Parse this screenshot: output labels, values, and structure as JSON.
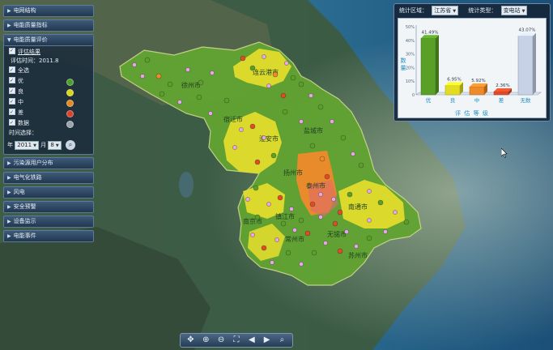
{
  "sidebar": {
    "top_items": [
      {
        "label": "电网结构"
      },
      {
        "label": "电能质量指标"
      }
    ],
    "panel": {
      "title": "电能质量评价",
      "sub_label": "评估结果",
      "time_text": "评估时间：2011.8",
      "legend": [
        {
          "label": "全选",
          "color": ""
        },
        {
          "label": "优",
          "color": "#4b9e2b"
        },
        {
          "label": "良",
          "color": "#d8d51a"
        },
        {
          "label": "中",
          "color": "#e08a24"
        },
        {
          "label": "差",
          "color": "#d9432a"
        },
        {
          "label": "数据",
          "color": "#9aa4ad"
        }
      ],
      "query_label": "时间选择：",
      "year_label": "年",
      "year_value": "2011",
      "month_label": "月",
      "month_value": "8"
    },
    "bottom_items": [
      {
        "label": "污染源用户分布"
      },
      {
        "label": "电气化铁路"
      },
      {
        "label": "风电"
      },
      {
        "label": "安全预警"
      },
      {
        "label": "设备监示"
      },
      {
        "label": "电能事件"
      }
    ]
  },
  "chart_panel": {
    "region_label": "统计区域：",
    "region_value": "江苏省",
    "type_label": "统计类型：",
    "type_value": "变电站",
    "y_title": "数量",
    "x_title": "评 估 等 级"
  },
  "chart_data": {
    "type": "bar",
    "categories": [
      "优",
      "良",
      "中",
      "差",
      "无数"
    ],
    "values": [
      41.49,
      6.95,
      5.92,
      2.36,
      43.07
    ],
    "value_labels": [
      "41.49%",
      "6.95%",
      "5.92%",
      "2.36%",
      "43.07%"
    ],
    "colors": [
      "#5aa028",
      "#e2dd22",
      "#ef8a2a",
      "#e04b28",
      "#c8d2e6"
    ],
    "ylim": [
      0,
      50
    ],
    "yticks": [
      "0",
      "10",
      "20",
      "30",
      "40",
      "50"
    ],
    "yticks_text": [
      "0",
      "10%",
      "20%",
      "30%",
      "40%",
      "50%"
    ],
    "grid": false,
    "style": "3d"
  },
  "map": {
    "city_labels": [
      "徐州市",
      "连云港市",
      "宿迁市",
      "淮安市",
      "盐城市",
      "扬州市",
      "泰州市",
      "南通市",
      "南京市",
      "镇江市",
      "常州市",
      "无锡市",
      "苏州市"
    ],
    "colors": {
      "good": "#5aa028",
      "fair": "#e2dd22",
      "medium": "#ef8a2a",
      "poor": "#e04b28",
      "user": "#e6a6e8"
    }
  },
  "toolbar": {
    "tools": [
      {
        "name": "pan-icon",
        "glyph": "✥"
      },
      {
        "name": "zoom-in-icon",
        "glyph": "⊕"
      },
      {
        "name": "zoom-out-icon",
        "glyph": "⊖"
      },
      {
        "name": "full-extent-icon",
        "glyph": "⛶"
      },
      {
        "name": "back-icon",
        "glyph": "◀"
      },
      {
        "name": "forward-icon",
        "glyph": "▶"
      },
      {
        "name": "search-icon",
        "glyph": "⌕"
      }
    ]
  }
}
